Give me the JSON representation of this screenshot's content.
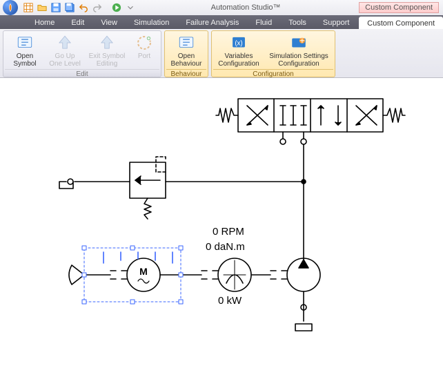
{
  "titlebar": {
    "app_title": "Automation Studio™",
    "custom_component_label": "Custom Component"
  },
  "tabs": {
    "items": [
      {
        "label": "Home"
      },
      {
        "label": "Edit"
      },
      {
        "label": "View"
      },
      {
        "label": "Simulation"
      },
      {
        "label": "Failure Analysis"
      },
      {
        "label": "Fluid"
      },
      {
        "label": "Tools"
      },
      {
        "label": "Support"
      }
    ],
    "active_label": "Custom Component"
  },
  "ribbon": {
    "edit_group": {
      "label": "Edit",
      "open_symbol": "Open\nSymbol",
      "go_up": "Go Up\nOne Level",
      "exit_symbol": "Exit Symbol\nEditing",
      "port": "Port"
    },
    "behaviour_group": {
      "label": "Behaviour",
      "open_behaviour": "Open\nBehaviour"
    },
    "config_group": {
      "label": "Configuration",
      "variables": "Variables\nConfiguration",
      "sim_settings": "Simulation Settings\nConfiguration"
    }
  },
  "chart_data": {
    "type": "diagram",
    "description": "Hydraulic schematic with electric motor, torque sensor, pump, relief valve and directional control valve",
    "readouts": {
      "speed": {
        "value": 0,
        "unit": "RPM"
      },
      "torque": {
        "value": 0,
        "unit": "daN.m"
      },
      "power": {
        "value": 0,
        "unit": "kW"
      }
    }
  }
}
